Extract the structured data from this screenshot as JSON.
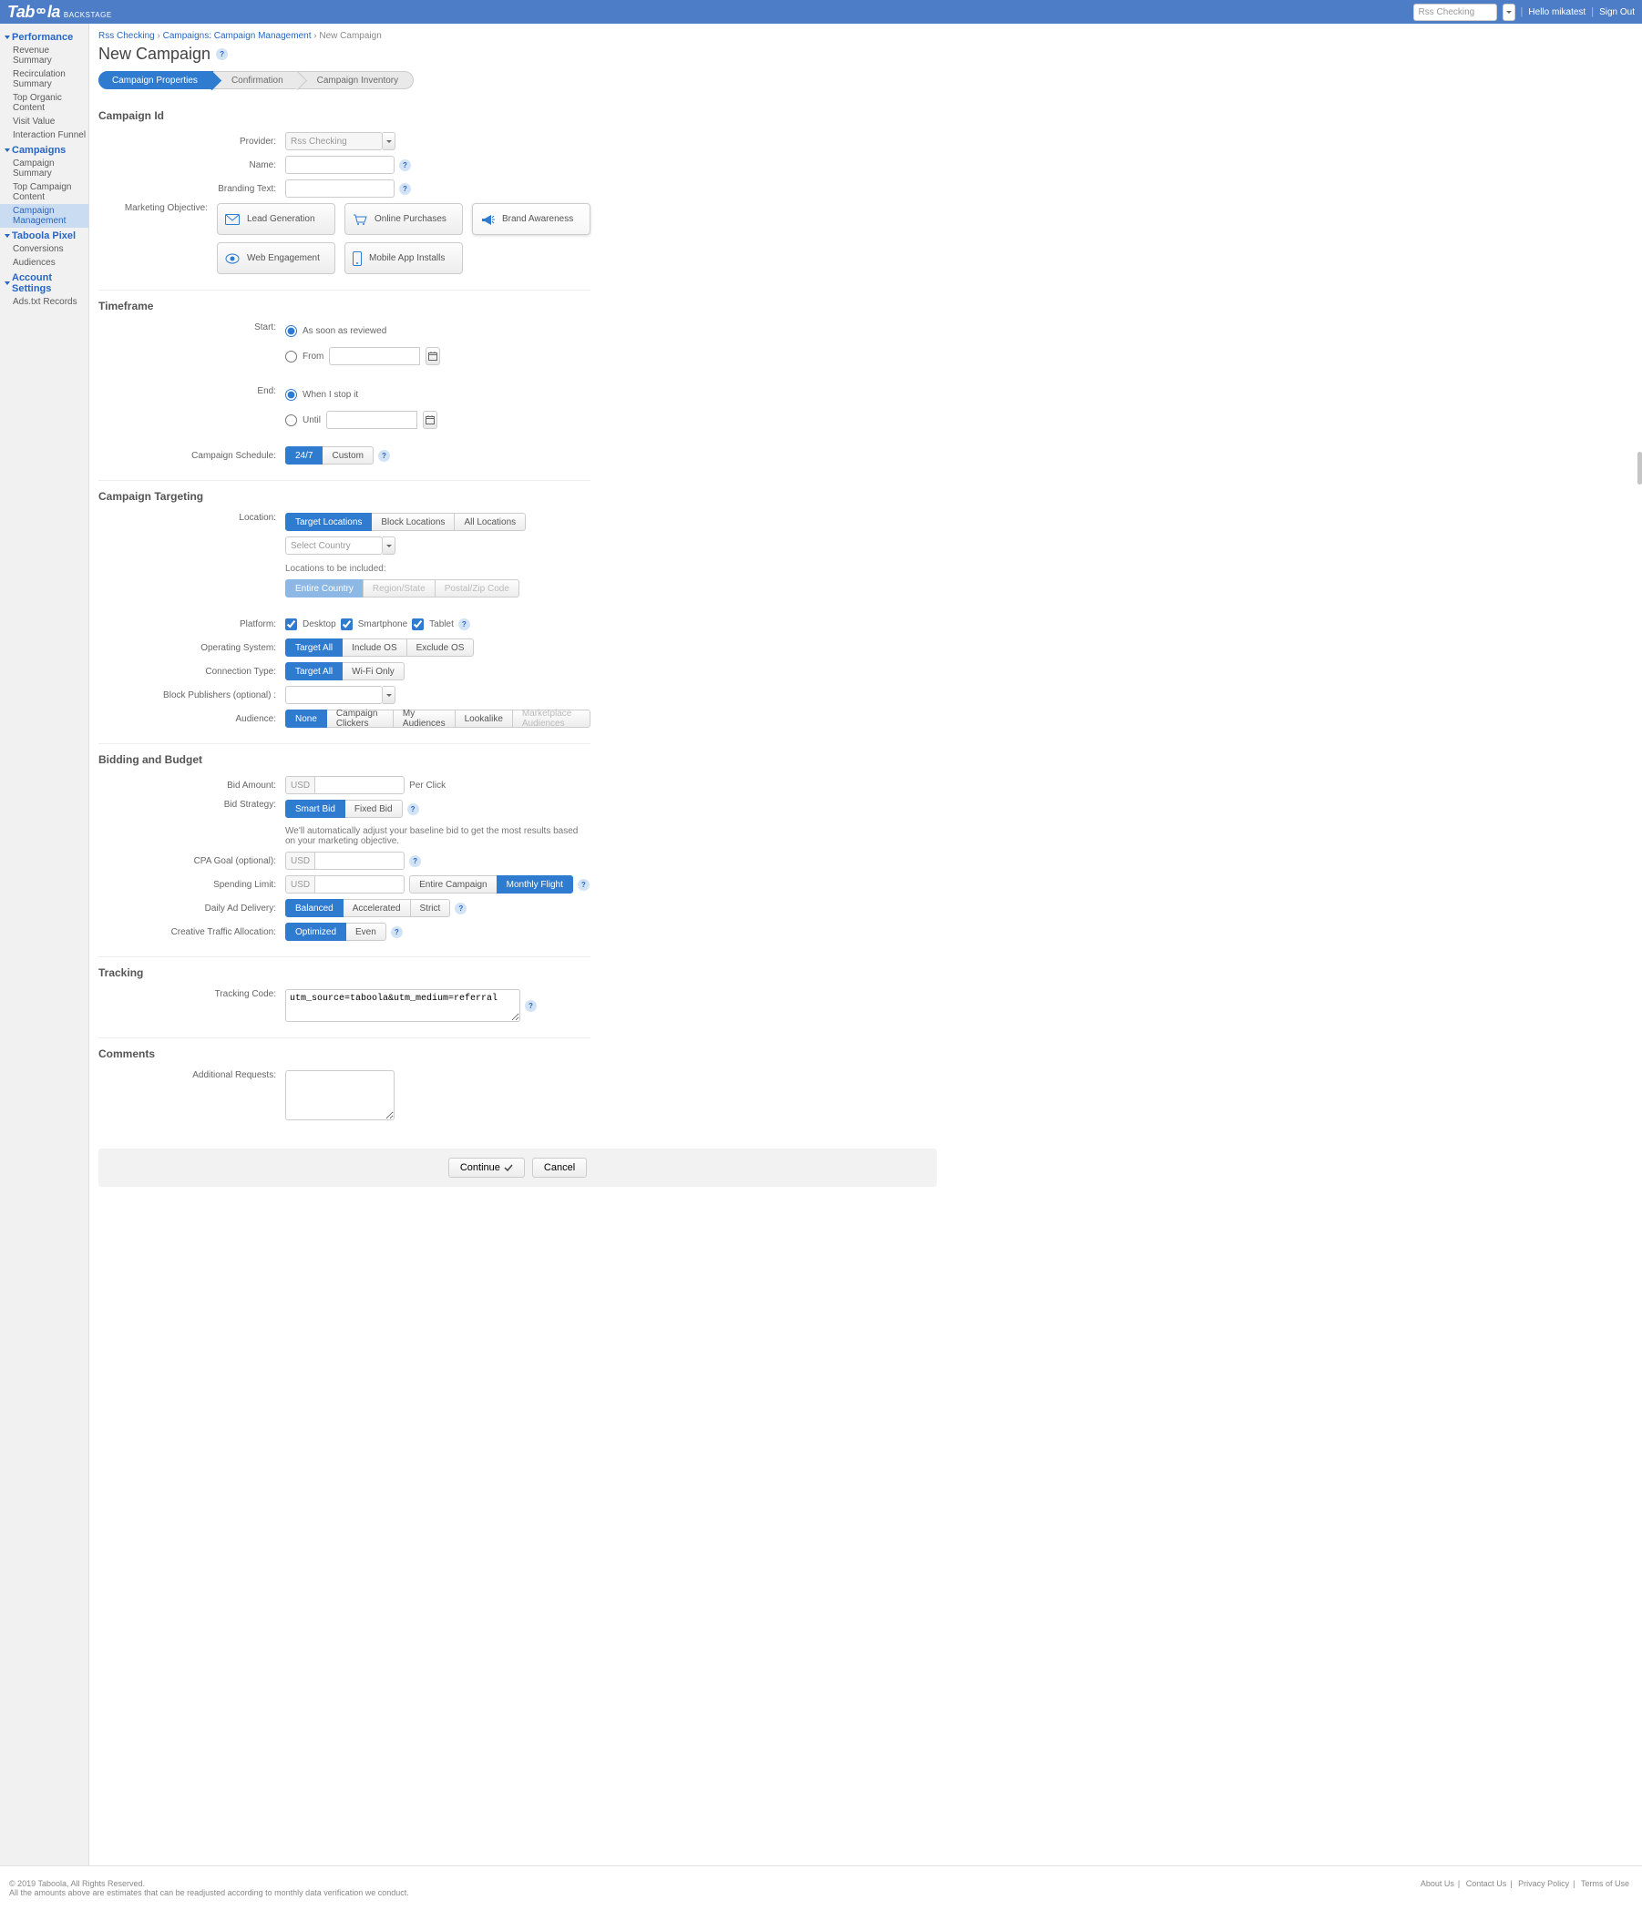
{
  "header": {
    "logo": "Tab",
    "logo2": "la",
    "sublogo": "BACKSTAGE",
    "accountPlaceholder": "Rss Checking",
    "hello": "Hello mikatest",
    "signout": "Sign Out"
  },
  "sidebar": {
    "sections": [
      {
        "title": "Performance",
        "items": [
          "Revenue Summary",
          "Recirculation Summary",
          "Top Organic Content",
          "Visit Value",
          "Interaction Funnel"
        ]
      },
      {
        "title": "Campaigns",
        "items": [
          "Campaign Summary",
          "Top Campaign Content",
          "Campaign Management"
        ],
        "activeIndex": 2
      },
      {
        "title": "Taboola Pixel",
        "items": [
          "Conversions",
          "Audiences"
        ]
      },
      {
        "title": "Account Settings",
        "items": [
          "Ads.txt Records"
        ]
      }
    ]
  },
  "breadcrumb": {
    "a": "Rss Checking",
    "b": "Campaigns: Campaign Management",
    "c": "New Campaign"
  },
  "pageTitle": "New Campaign",
  "wizard": [
    "Campaign Properties",
    "Confirmation",
    "Campaign Inventory"
  ],
  "sections": {
    "campaignId": {
      "title": "Campaign Id",
      "providerLabel": "Provider:",
      "providerValue": "Rss Checking",
      "nameLabel": "Name:",
      "brandingLabel": "Branding Text:",
      "objectiveLabel": "Marketing Objective:",
      "objectives": [
        "Lead Generation",
        "Online Purchases",
        "Brand Awareness",
        "Web Engagement",
        "Mobile App Installs"
      ]
    },
    "timeframe": {
      "title": "Timeframe",
      "startLabel": "Start:",
      "startAsap": "As soon as reviewed",
      "startFrom": "From",
      "endLabel": "End:",
      "endStop": "When I stop it",
      "endUntil": "Until",
      "scheduleLabel": "Campaign Schedule:",
      "scheduleOptions": [
        "24/7",
        "Custom"
      ]
    },
    "targeting": {
      "title": "Campaign Targeting",
      "locationLabel": "Location:",
      "locationOptions": [
        "Target Locations",
        "Block Locations",
        "All Locations"
      ],
      "selectCountry": "Select Country",
      "locIncluded": "Locations to be included:",
      "scopeOptions": [
        "Entire Country",
        "Region/State",
        "Postal/Zip Code"
      ],
      "platformLabel": "Platform:",
      "platforms": [
        "Desktop",
        "Smartphone",
        "Tablet"
      ],
      "osLabel": "Operating System:",
      "osOptions": [
        "Target All",
        "Include OS",
        "Exclude OS"
      ],
      "connLabel": "Connection Type:",
      "connOptions": [
        "Target All",
        "Wi-Fi Only"
      ],
      "blockPubLabel": "Block Publishers (optional) :",
      "audienceLabel": "Audience:",
      "audienceOptions": [
        "None",
        "Campaign Clickers",
        "My Audiences",
        "Lookalike",
        "Marketplace Audiences"
      ]
    },
    "bidding": {
      "title": "Bidding and Budget",
      "bidAmountLabel": "Bid Amount:",
      "currency": "USD",
      "perClick": "Per Click",
      "bidStrategyLabel": "Bid Strategy:",
      "strategyOptions": [
        "Smart Bid",
        "Fixed Bid"
      ],
      "strategyNote": "We'll automatically adjust your baseline bid to get the most results based on your marketing objective.",
      "cpaLabel": "CPA Goal (optional):",
      "spendingLabel": "Spending Limit:",
      "spendingOptions": [
        "Entire Campaign",
        "Monthly Flight"
      ],
      "dailyLabel": "Daily Ad Delivery:",
      "dailyOptions": [
        "Balanced",
        "Accelerated",
        "Strict"
      ],
      "creativeLabel": "Creative Traffic Allocation:",
      "creativeOptions": [
        "Optimized",
        "Even"
      ]
    },
    "tracking": {
      "title": "Tracking",
      "codeLabel": "Tracking Code:",
      "codeValue": "utm_source=taboola&utm_medium=referral"
    },
    "comments": {
      "title": "Comments",
      "addlLabel": "Additional Requests:"
    }
  },
  "buttons": {
    "continue": "Continue",
    "cancel": "Cancel"
  },
  "footer": {
    "copyright": "© 2019 Taboola, All Rights Reserved.",
    "note": "All the amounts above are estimates that can be readjusted according to monthly data verification we conduct.",
    "links": [
      "About Us",
      "Contact Us",
      "Privacy Policy",
      "Terms of Use"
    ]
  }
}
